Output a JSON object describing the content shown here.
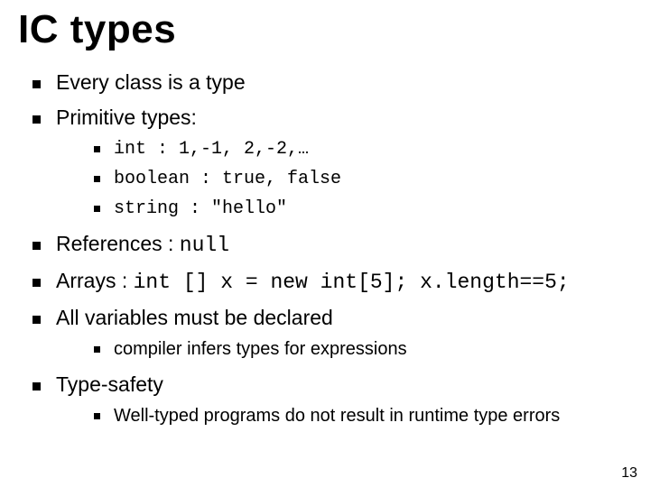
{
  "title": "IC types",
  "b1": "Every class is a type",
  "b2": "Primitive types:",
  "s1": "int : 1,-1, 2,-2,…",
  "s2": "boolean : true, false",
  "s3": "string : \"hello\"",
  "b3_pre": "References : ",
  "b3_code": "null",
  "b4_pre": "Arrays : ",
  "b4_code": "int [] x = new int[5];   x.length==5;",
  "b5": "All variables must be declared",
  "s4": "compiler infers types for expressions",
  "b6": "Type-safety",
  "s5": "Well-typed programs do not result in runtime type errors",
  "page": "13"
}
